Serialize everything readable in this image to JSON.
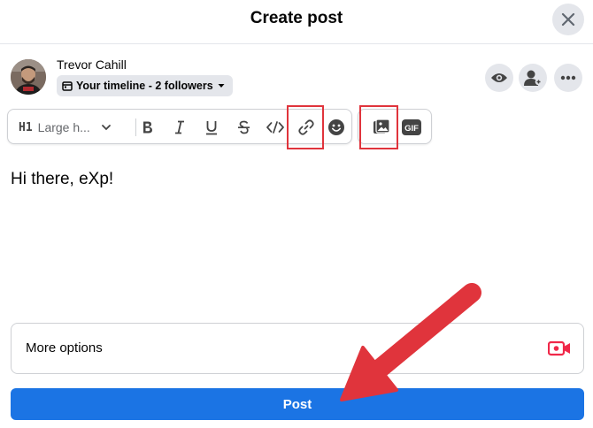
{
  "header": {
    "title": "Create post"
  },
  "user": {
    "name": "Trevor Cahill",
    "audience": "Your timeline - 2 followers"
  },
  "toolbar": {
    "heading_tag": "H1",
    "heading_label": "Large h..."
  },
  "composer": {
    "text": "Hi there, eXp!"
  },
  "more_options": {
    "label": "More options"
  },
  "post_button": {
    "label": "Post"
  },
  "colors": {
    "accent": "#1b74e4",
    "annotation": "#e0343c",
    "video_icon": "#f02849"
  },
  "icons": [
    "close-icon",
    "calendar-icon",
    "chevron-down-icon",
    "eye-icon",
    "person-add-icon",
    "more-icon",
    "chevron-down-icon",
    "bold-icon",
    "italic-icon",
    "underline-icon",
    "strikethrough-icon",
    "code-icon",
    "link-icon",
    "emoji-icon",
    "image-icon",
    "gif-icon",
    "video-camera-icon"
  ]
}
